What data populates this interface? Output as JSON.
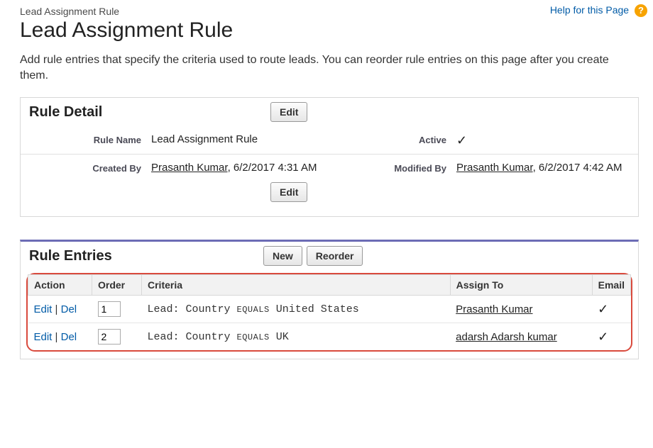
{
  "help": {
    "label": "Help for this Page"
  },
  "breadcrumb": "Lead Assignment Rule",
  "title": "Lead Assignment Rule",
  "description": "Add rule entries that specify the criteria used to route leads. You can reorder rule entries on this page after you create them.",
  "detail": {
    "section_title": "Rule Detail",
    "edit_label": "Edit",
    "rule_name_label": "Rule Name",
    "rule_name_value": "Lead Assignment Rule",
    "active_label": "Active",
    "active_value": "✓",
    "created_by_label": "Created By",
    "created_by_name": "Prasanth Kumar",
    "created_by_time": ", 6/2/2017 4:31 AM",
    "modified_by_label": "Modified By",
    "modified_by_name": "Prasanth Kumar",
    "modified_by_time": ", 6/2/2017 4:42 AM"
  },
  "entries": {
    "section_title": "Rule Entries",
    "new_label": "New",
    "reorder_label": "Reorder",
    "columns": {
      "action": "Action",
      "order": "Order",
      "criteria": "Criteria",
      "assign_to": "Assign To",
      "email": "Email"
    },
    "action_edit": "Edit",
    "action_del": "Del",
    "rows": [
      {
        "order": "1",
        "criteria_prefix": "Lead: Country ",
        "criteria_op": "EQUALS",
        "criteria_value": " United States",
        "assign_to": "Prasanth Kumar",
        "email_checked": "✓"
      },
      {
        "order": "2",
        "criteria_prefix": "Lead: Country ",
        "criteria_op": "EQUALS",
        "criteria_value": " UK",
        "assign_to": "adarsh Adarsh kumar",
        "email_checked": "✓"
      }
    ]
  }
}
